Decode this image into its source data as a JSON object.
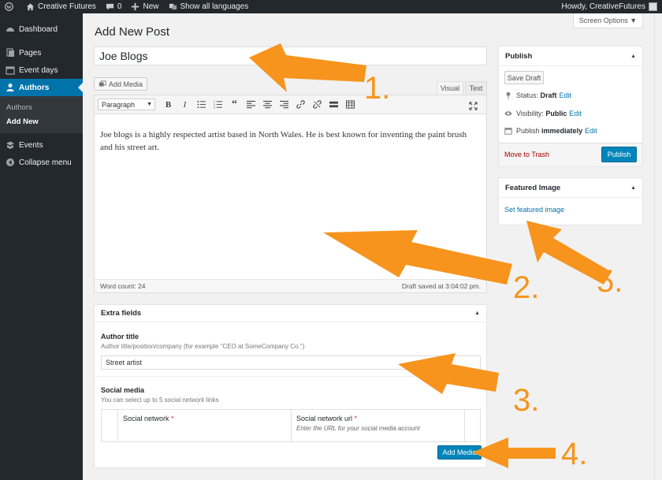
{
  "adminbar": {
    "site_name": "Creative Futures",
    "comments_count": "0",
    "new_label": "New",
    "languages_label": "Show all languages",
    "howdy": "Howdy, CreativeFutures"
  },
  "sidebar": {
    "items": [
      {
        "label": "Dashboard",
        "icon": "dashboard-icon"
      },
      {
        "label": "Pages",
        "icon": "pages-icon"
      },
      {
        "label": "Event days",
        "icon": "calendar-icon"
      },
      {
        "label": "Authors",
        "icon": "user-icon"
      },
      {
        "label": "Events",
        "icon": "events-icon"
      },
      {
        "label": "Collapse menu",
        "icon": "collapse-icon"
      }
    ],
    "submenu": [
      "Authors",
      "Add New"
    ]
  },
  "page": {
    "title": "Add New Post",
    "screen_options": "Screen Options ▼"
  },
  "post": {
    "title": "Joe Blogs",
    "add_media": "Add Media",
    "tab_visual": "Visual",
    "tab_text": "Text",
    "format": "Paragraph",
    "body": "Joe blogs is a highly respected artist based in North Wales. He is best known for inventing the paint brush and his street art.",
    "word_count": "Word count: 24",
    "draft_saved": "Draft saved at 3:04:02 pm."
  },
  "extra_fields": {
    "heading": "Extra fields",
    "author_title_label": "Author title",
    "author_title_desc": "Author title/position/company (for example \"CEO at SomeCompany Co.\")",
    "author_title_value": "Street artist",
    "social_label": "Social media",
    "social_desc": "You can select up to 5 social network links",
    "col_network": "Social network",
    "col_url": "Social network url",
    "url_hint": "Enter the URL for your social media account",
    "required_mark": "*",
    "add_button": "Add Media"
  },
  "publish": {
    "heading": "Publish",
    "save_draft": "Save Draft",
    "status_label": "Status:",
    "status_value": "Draft",
    "visibility_label": "Visibility:",
    "visibility_value": "Public",
    "publish_label": "Publish",
    "publish_value": "immediately",
    "edit": "Edit",
    "move_trash": "Move to Trash",
    "publish_button": "Publish"
  },
  "featured": {
    "heading": "Featured Image",
    "link": "Set featured image"
  },
  "annotations": {
    "color": "#f7941d",
    "steps": [
      "1.",
      "2.",
      "3.",
      "4.",
      "5."
    ]
  },
  "colors": {
    "admin_dark": "#23282d",
    "accent": "#0073aa",
    "button_blue": "#0085ba"
  }
}
